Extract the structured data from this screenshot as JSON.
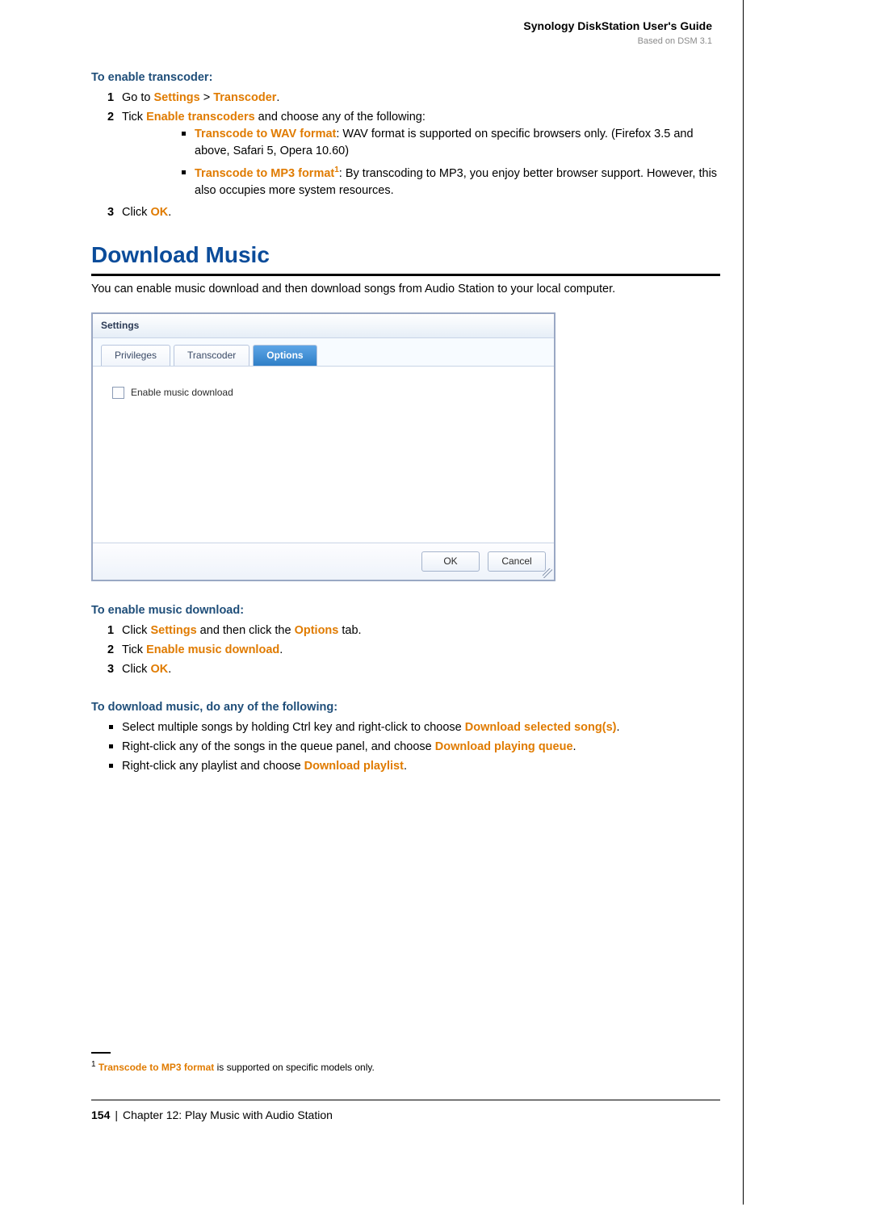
{
  "header": {
    "main": "Synology DiskStation User's Guide",
    "sub": "Based on DSM 3.1"
  },
  "sectionA": {
    "title": "To enable transcoder:",
    "step1_prefix": "Go to ",
    "step1_link1": "Settings",
    "step1_gt": " > ",
    "step1_link2": "Transcoder",
    "step1_suffix": ".",
    "step2_prefix": "Tick ",
    "step2_link": "Enable transcoders",
    "step2_suffix": " and choose any of the following:",
    "sub1_bold": "Transcode to WAV format",
    "sub1_text": ": WAV format is supported on specific browsers only. (Firefox 3.5 and above, Safari 5, Opera 10.60)",
    "sub2_bold": "Transcode to MP3 format",
    "sub2_sup": "1",
    "sub2_text": ": By transcoding to MP3, you enjoy better browser support. However, this also occupies more system resources.",
    "step3_prefix": "Click ",
    "step3_link": "OK",
    "step3_suffix": "."
  },
  "h2": "Download Music",
  "intro": "You can enable music download and then download songs from Audio Station to your local computer.",
  "dialog": {
    "title": "Settings",
    "tab1": "Privileges",
    "tab2": "Transcoder",
    "tab3": "Options",
    "checkbox_label": "Enable music download",
    "ok": "OK",
    "cancel": "Cancel"
  },
  "sectionB": {
    "title": "To enable music download:",
    "s1_prefix": "Click ",
    "s1_link1": "Settings",
    "s1_mid": " and then click the ",
    "s1_link2": "Options",
    "s1_suffix": " tab.",
    "s2_prefix": "Tick ",
    "s2_link": "Enable music download",
    "s2_suffix": ".",
    "s3_prefix": "Click ",
    "s3_link": "OK",
    "s3_suffix": "."
  },
  "sectionC": {
    "title": "To download music, do any of the following:",
    "b1_prefix": "Select multiple songs by holding Ctrl key and right-click to choose ",
    "b1_link": "Download selected song(s)",
    "b1_suffix": ".",
    "b2_prefix": "Right-click any of the songs in the queue panel, and choose ",
    "b2_link": "Download playing queue",
    "b2_suffix": ".",
    "b3_prefix": "Right-click any playlist and choose ",
    "b3_link": "Download playlist",
    "b3_suffix": "."
  },
  "footnote": {
    "sup": "1",
    "bold": "Transcode to MP3 format",
    "text": " is supported on specific models only."
  },
  "footer": {
    "page": "154",
    "chapter": "Chapter 12: Play Music with Audio Station"
  }
}
